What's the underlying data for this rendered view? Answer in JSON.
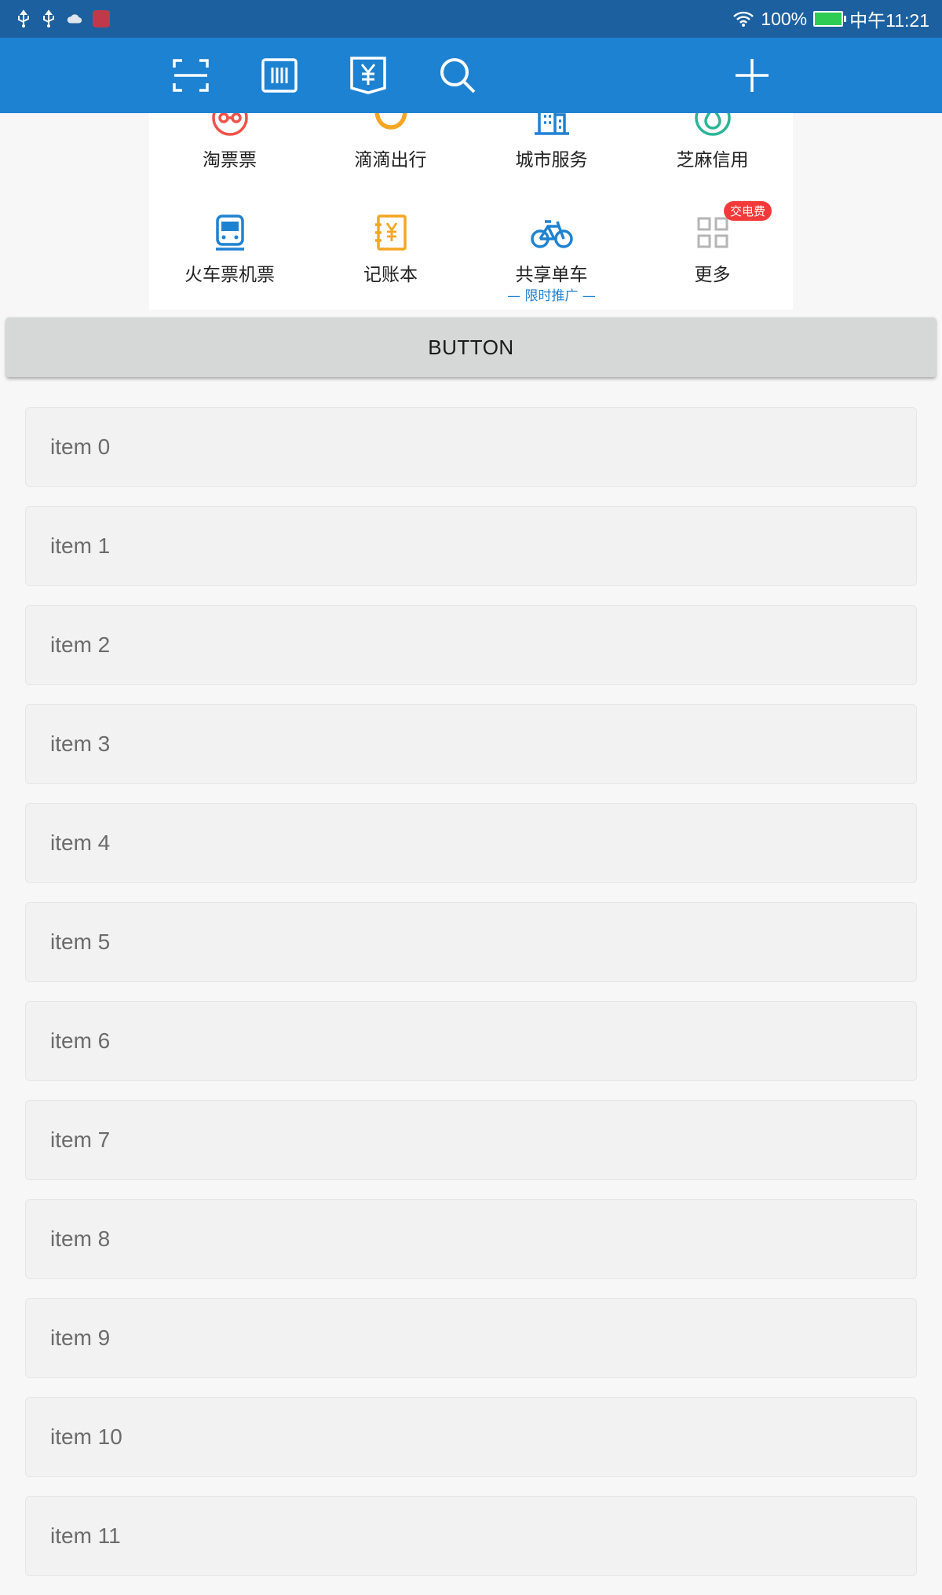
{
  "status_bar": {
    "battery_percent": "100%",
    "time": "中午11:21"
  },
  "toolbar": {
    "icons": [
      "scan-icon",
      "barcode-icon",
      "payment-yuan-icon",
      "search-icon",
      "plus-icon"
    ]
  },
  "apps": [
    {
      "label": "淘票票",
      "icon": "glasses-face-icon",
      "color": "#f0524a"
    },
    {
      "label": "滴滴出行",
      "icon": "didi-icon",
      "color": "#f5a623"
    },
    {
      "label": "城市服务",
      "icon": "building-icon",
      "color": "#1e82d2"
    },
    {
      "label": "芝麻信用",
      "icon": "sesame-drop-icon",
      "color": "#2bb596"
    },
    {
      "label": "火车票机票",
      "icon": "train-icon",
      "color": "#1e82d2"
    },
    {
      "label": "记账本",
      "icon": "ledger-yuan-icon",
      "color": "#f5a623"
    },
    {
      "label": "共享单车",
      "sub": "限时推广",
      "icon": "bicycle-icon",
      "color": "#1e82d2"
    },
    {
      "label": "更多",
      "icon": "grid-more-icon",
      "color": "#b5b5b5",
      "badge": "交电费"
    }
  ],
  "main_button": {
    "label": "BUTTON"
  },
  "list": {
    "items": [
      "item 0",
      "item 1",
      "item 2",
      "item 3",
      "item 4",
      "item 5",
      "item 6",
      "item 7",
      "item 8",
      "item 9",
      "item 10",
      "item 11"
    ]
  }
}
